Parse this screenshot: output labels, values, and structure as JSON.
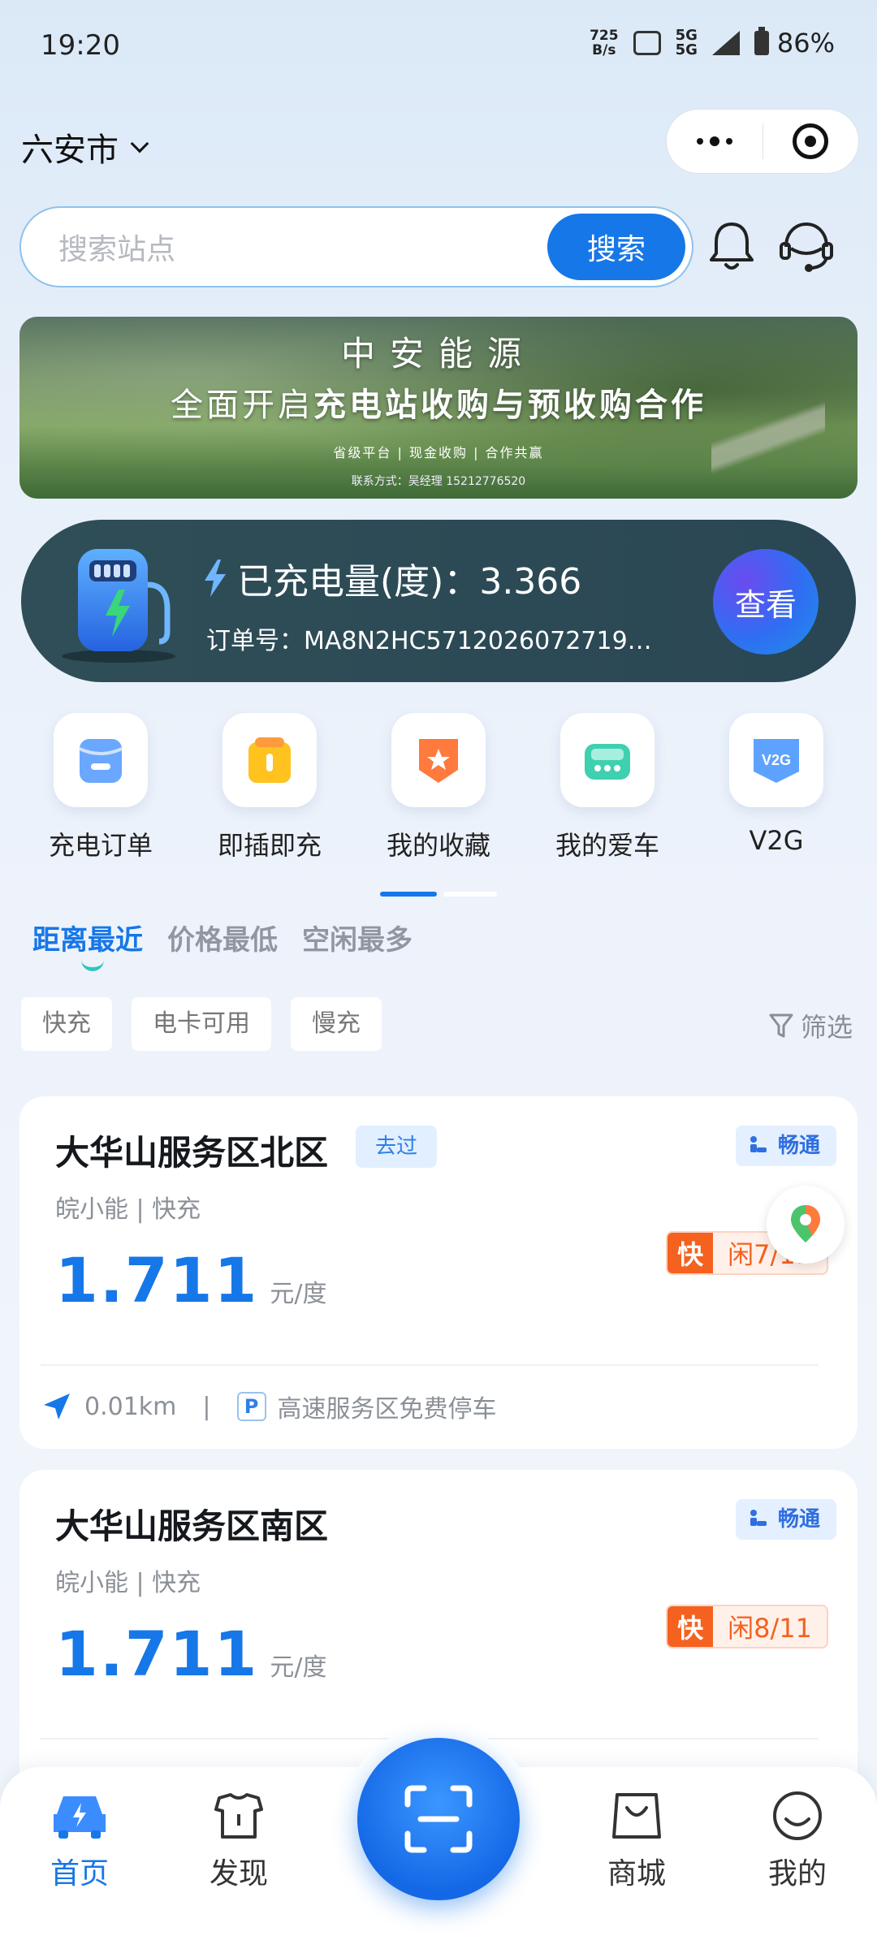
{
  "status_bar": {
    "time": "19:20",
    "net_speed_value": "725",
    "net_speed_unit": "B/s",
    "network": "5G",
    "battery": "86%"
  },
  "header": {
    "city": "六安市"
  },
  "search": {
    "placeholder": "搜索站点",
    "button_label": "搜索"
  },
  "banner": {
    "title": "中安能源",
    "subtitle_prefix": "全面开启",
    "subtitle_bold": "充电站收购与预收购合作",
    "tags": "省级平台 | 现金收购 | 合作共赢",
    "contact": "联系方式：吴经理 15212776520"
  },
  "charge_card": {
    "amount_label": "已充电量(度)：3.366",
    "order_label": "订单号：MA8N2HC5712026072719…",
    "view_button": "查看"
  },
  "quick_entries": [
    {
      "label": "充电订单",
      "icon": "charging-order-icon"
    },
    {
      "label": "即插即充",
      "icon": "plug-and-charge-icon"
    },
    {
      "label": "我的收藏",
      "icon": "favorites-icon"
    },
    {
      "label": "我的爱车",
      "icon": "my-car-icon"
    },
    {
      "label": "V2G",
      "icon": "v2g-icon"
    }
  ],
  "v2g_icon_text": "V2G",
  "sort_tabs": [
    {
      "label": "距离最近",
      "active": true
    },
    {
      "label": "价格最低",
      "active": false
    },
    {
      "label": "空闲最多",
      "active": false
    }
  ],
  "filter_chips": [
    "快充",
    "电卡可用",
    "慢充"
  ],
  "filter_label": "筛选",
  "stations": [
    {
      "name": "大华山服务区北区",
      "visited_badge": "去过",
      "traffic": "畅通",
      "operator": "皖小能 | 快充",
      "price": "1.711",
      "price_unit": "元/度",
      "fast_key": "快",
      "fast_value": "闲7/11",
      "distance": "0.01km",
      "parking": "高速服务区免费停车"
    },
    {
      "name": "大华山服务区南区",
      "traffic": "畅通",
      "operator": "皖小能 | 快充",
      "price": "1.711",
      "price_unit": "元/度",
      "fast_key": "快",
      "fast_value": "闲8/11"
    }
  ],
  "bottom_nav": [
    {
      "label": "首页",
      "active": true
    },
    {
      "label": "发现",
      "active": false
    },
    {
      "label": "商城",
      "active": false
    },
    {
      "label": "我的",
      "active": false
    }
  ],
  "colors": {
    "primary": "#1677e8",
    "accent_orange": "#f5611f",
    "charge_card_bg": "#2f4e57"
  }
}
